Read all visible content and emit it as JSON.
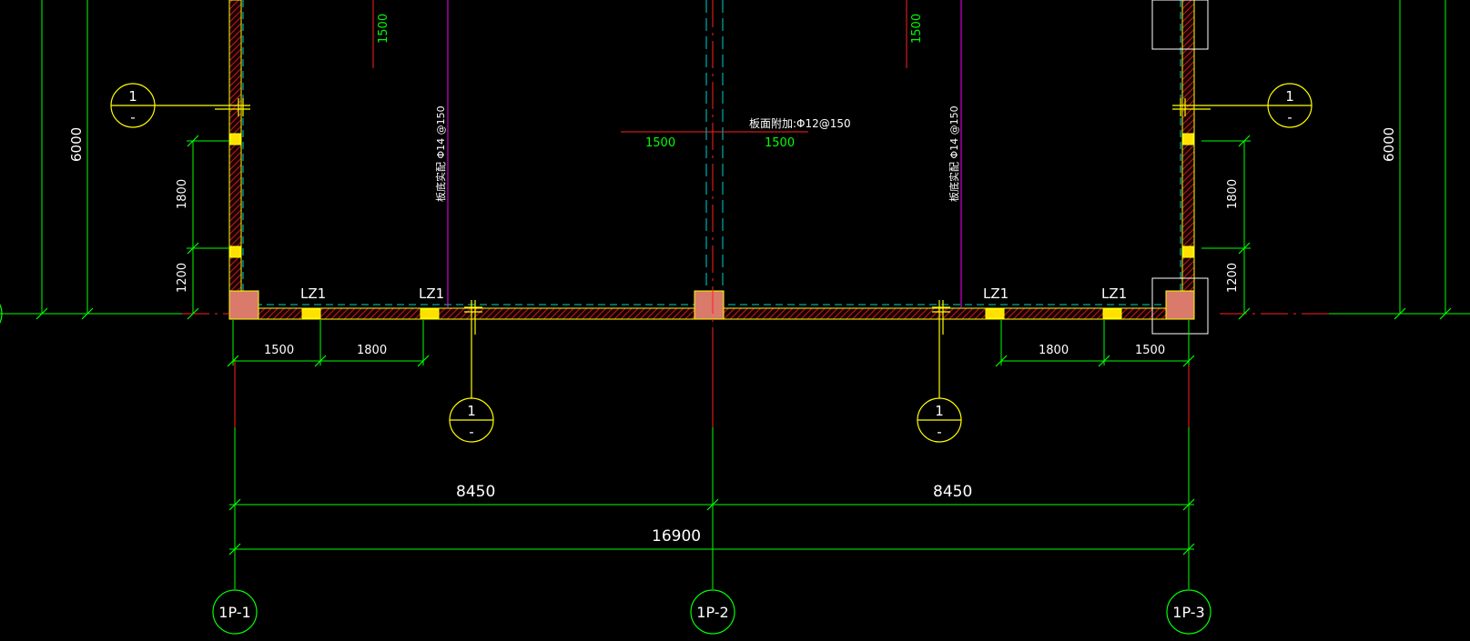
{
  "drawing": {
    "colors": {
      "background": "#000000",
      "dimension": "#00ff00",
      "wall_outline": "#ffff00",
      "wall_hatch": "#c02020",
      "column_fill": "#d97a6a",
      "lintel_fill": "#ffe000",
      "axis_cyan": "#00d0d0",
      "axis_red": "#ff2020",
      "magenta": "#ff00ff",
      "section_marker": "#ffff00",
      "grid_bubble": "#00ff00",
      "text_white": "#ffffff"
    },
    "grid_labels": [
      "1P-1",
      "1P-2",
      "1P-3"
    ],
    "dimensions": {
      "span_left": "8450",
      "span_right": "8450",
      "total": "16900",
      "left_1500": "1500",
      "left_1800": "1800",
      "right_1800": "1800",
      "right_1500": "1500",
      "left_vert_1800": "1800",
      "left_vert_1200": "1200",
      "right_vert_1800": "1800",
      "right_vert_1200": "1200",
      "left_height": "6000",
      "right_height": "6000"
    },
    "rebar": {
      "center_label": "板面附加:Φ12@150",
      "center_left_len": "1500",
      "center_right_len": "1500",
      "left_top_len": "1500",
      "right_top_len": "1500",
      "left_vertical_label": "板底实配 Φ14 @150",
      "right_vertical_label": "板底实配 Φ14 @150"
    },
    "lintel_labels": [
      "LZ1",
      "LZ1",
      "LZ1",
      "LZ1"
    ],
    "section_markers": [
      {
        "top": "1",
        "bottom": "-"
      },
      {
        "top": "1",
        "bottom": "-"
      },
      {
        "top": "1",
        "bottom": "-"
      },
      {
        "top": "1",
        "bottom": "-"
      }
    ]
  }
}
